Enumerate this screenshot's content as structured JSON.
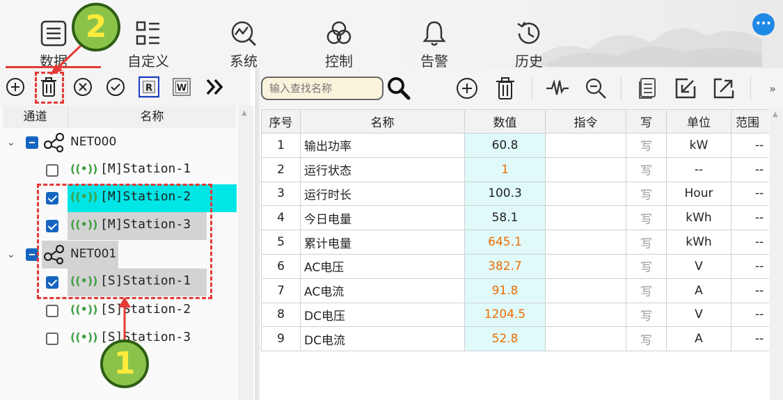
{
  "nav": {
    "items": [
      {
        "label": "数据",
        "icon": "data-icon"
      },
      {
        "label": "自定义",
        "icon": "custom-icon"
      },
      {
        "label": "系统",
        "icon": "system-icon"
      },
      {
        "label": "控制",
        "icon": "control-icon"
      },
      {
        "label": "告警",
        "icon": "bell-icon"
      },
      {
        "label": "历史",
        "icon": "history-icon"
      }
    ],
    "more_label": "···"
  },
  "left_toolbar": {
    "icons": [
      "add-icon",
      "delete-icon",
      "close-circle-icon",
      "check-circle-icon",
      "read-icon",
      "write-icon",
      "expand-more-icon"
    ],
    "read_label": "R",
    "write_label": "W"
  },
  "tree": {
    "headers": {
      "channel": "通道",
      "name": "名称"
    },
    "nodes": [
      {
        "type": "net",
        "label": "NET000",
        "state": "partial"
      },
      {
        "type": "station",
        "label": "[M]Station-1",
        "checked": false
      },
      {
        "type": "station",
        "label": "[M]Station-2",
        "checked": true,
        "selected": true
      },
      {
        "type": "station",
        "label": "[M]Station-3",
        "checked": true
      },
      {
        "type": "net",
        "label": "NET001",
        "state": "partial"
      },
      {
        "type": "station",
        "label": "[S]Station-1",
        "checked": true
      },
      {
        "type": "station",
        "label": "[S]Station-2",
        "checked": false
      },
      {
        "type": "station",
        "label": "[S]Station-3",
        "checked": false
      }
    ]
  },
  "right_toolbar": {
    "search_placeholder": "输入查找名称",
    "more": "»"
  },
  "table": {
    "headers": [
      "序号",
      "名称",
      "数值",
      "指令",
      "写",
      "单位",
      "范围"
    ],
    "rows": [
      {
        "no": "1",
        "name": "输出功率",
        "value": "60.8",
        "orange": false,
        "cmd": "",
        "write": "写",
        "unit": "kW",
        "range": "--"
      },
      {
        "no": "2",
        "name": "运行状态",
        "value": "1",
        "orange": true,
        "cmd": "",
        "write": "写",
        "unit": "--",
        "range": "--"
      },
      {
        "no": "3",
        "name": "运行时长",
        "value": "100.3",
        "orange": false,
        "cmd": "",
        "write": "写",
        "unit": "Hour",
        "range": "--"
      },
      {
        "no": "4",
        "name": "今日电量",
        "value": "58.1",
        "orange": false,
        "cmd": "",
        "write": "写",
        "unit": "kWh",
        "range": "--"
      },
      {
        "no": "5",
        "name": "累计电量",
        "value": "645.1",
        "orange": true,
        "cmd": "",
        "write": "写",
        "unit": "kWh",
        "range": "--"
      },
      {
        "no": "6",
        "name": "AC电压",
        "value": "382.7",
        "orange": true,
        "cmd": "",
        "write": "写",
        "unit": "V",
        "range": "--"
      },
      {
        "no": "7",
        "name": "AC电流",
        "value": "91.8",
        "orange": true,
        "cmd": "",
        "write": "写",
        "unit": "A",
        "range": "--"
      },
      {
        "no": "8",
        "name": "DC电压",
        "value": "1204.5",
        "orange": true,
        "cmd": "",
        "write": "写",
        "unit": "V",
        "range": "--"
      },
      {
        "no": "9",
        "name": "DC电流",
        "value": "52.8",
        "orange": true,
        "cmd": "",
        "write": "写",
        "unit": "A",
        "range": "--"
      }
    ]
  },
  "annotations": {
    "badge_1": "1",
    "badge_2": "2"
  },
  "colors": {
    "accent_red": "#e53935",
    "selected_row": "#00e5e5",
    "value_cell": "#e0fafa",
    "value_orange": "#ef6c00",
    "checkbox_blue": "#1565c0",
    "signal_green": "#43a047",
    "badge_green": "#8bc34a"
  }
}
